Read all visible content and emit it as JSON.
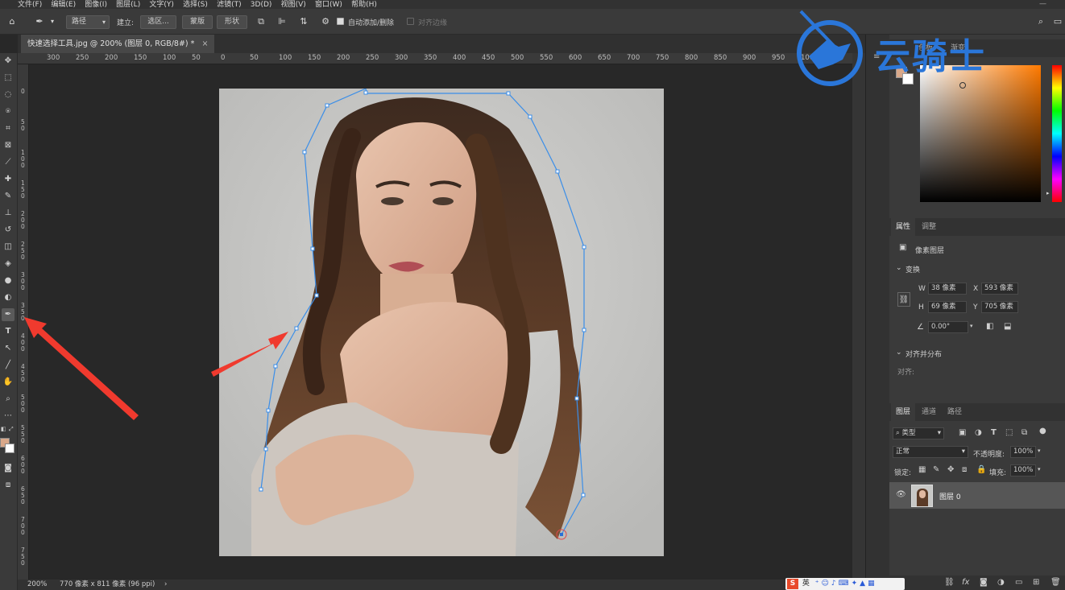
{
  "menu": [
    "文件(F)",
    "编辑(E)",
    "图像(I)",
    "图层(L)",
    "文字(Y)",
    "选择(S)",
    "滤镜(T)",
    "3D(D)",
    "视图(V)",
    "窗口(W)",
    "帮助(H)"
  ],
  "options": {
    "mode_value": "路径",
    "make_label": "建立:",
    "selection_btn": "选区...",
    "mask_btn": "蒙版",
    "shape_btn": "形状",
    "auto_add_delete": "自动添加/删除",
    "align_edges": "对齐边缘"
  },
  "document": {
    "tab_title": "快速选择工具.jpg @ 200% (图层 0, RGB/8#) *",
    "zoom": "200%",
    "info": "770 像素 x 811 像素 (96 ppi)"
  },
  "ruler": {
    "h_ticks": [
      "300",
      "250",
      "200",
      "150",
      "100",
      "50",
      "0",
      "50",
      "100",
      "150",
      "200",
      "250",
      "300",
      "350",
      "400",
      "450",
      "500",
      "550",
      "600",
      "650",
      "700",
      "750",
      "800",
      "850",
      "900",
      "950",
      "1000"
    ],
    "v_ticks": [
      "0",
      "5\n0",
      "1\n0\n0",
      "1\n5\n0",
      "2\n0\n0",
      "2\n5\n0",
      "3\n0\n0",
      "3\n5\n0",
      "4\n0\n0",
      "4\n5\n0",
      "5\n0\n0",
      "5\n5\n0",
      "6\n0\n0",
      "6\n5\n0",
      "7\n0\n0",
      "7\n5\n0"
    ]
  },
  "color_panel": {
    "tabs": [
      "色板",
      "渐变"
    ],
    "foreground": "#d9a88a",
    "background": "#ffffff",
    "hue_base": "#ff7a00"
  },
  "properties": {
    "tabs": [
      "属性",
      "调整"
    ],
    "layer_type": "像素图层",
    "transform_title": "变换",
    "w_label": "W",
    "w_value": "38 像素",
    "h_label": "H",
    "h_value": "69 像素",
    "x_label": "X",
    "x_value": "593 像素",
    "y_label": "Y",
    "y_value": "705 像素",
    "angle_value": "0.00°",
    "align_title": "对齐并分布",
    "align_label": "对齐:"
  },
  "layers": {
    "tabs": [
      "图层",
      "通道",
      "路径"
    ],
    "filter_kind": "类型",
    "blend_mode": "正常",
    "opacity_label": "不透明度:",
    "opacity_value": "100%",
    "lock_label": "锁定:",
    "fill_label": "填充:",
    "fill_value": "100%",
    "items": [
      {
        "name": "图层 0"
      }
    ]
  },
  "logo_text": "云骑士",
  "ime_text": "英"
}
